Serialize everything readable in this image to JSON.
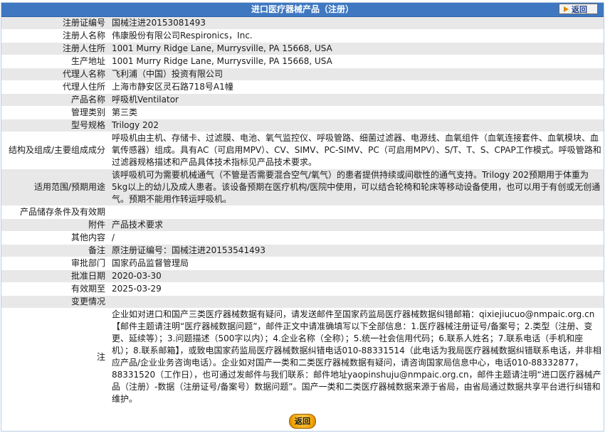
{
  "header": {
    "title": "进口医疗器械产品（注册）",
    "back_label": "返回"
  },
  "rows": [
    {
      "label": "注册证编号",
      "value": "国械注进20153081493"
    },
    {
      "label": "注册人名称",
      "value": "伟康股份有限公司Respironics，Inc."
    },
    {
      "label": "注册人住所",
      "value": "1001 Murry Ridge Lane, Murrysville, PA 15668, USA"
    },
    {
      "label": "生产地址",
      "value": "1001 Murry Ridge Lane, Murrysville, PA 15668, USA"
    },
    {
      "label": "代理人名称",
      "value": "飞利浦（中国）投资有限公司"
    },
    {
      "label": "代理人住所",
      "value": "上海市静安区灵石路718号A1幢"
    },
    {
      "label": "产品名称",
      "value": "呼吸机Ventilator"
    },
    {
      "label": "管理类别",
      "value": "第三类"
    },
    {
      "label": "型号规格",
      "value": "Trilogy 202"
    },
    {
      "label": "结构及组成/主要组成成分",
      "value": "呼吸机由主机、存储卡、过滤膜、电池、氧气监控仪、呼吸管路、细菌过滤器、电源线、血氧组件（血氧连接套件、血氧模块、血氧传感器）组成。具有AC（可启用MPV）、CV、SIMV、PC-SIMV、PC（可启用MPV）、S/T、T、S、CPAP工作模式。呼吸管路和过滤器规格描述和产品具体技术指标见产品技术要求。"
    },
    {
      "label": "适用范围/预期用途",
      "value": "该呼吸机可为需要机械通气（不管是否需要混合空气/氧气）的患者提供持续或间歇性的通气支持。Trilogy 202预期用于体重为5kg以上的幼儿及成人患者。该设备预期在医疗机构/医院中使用，可以结合轮椅和轮床等移动设备使用，也可以用于有创或无创通气。预期不能用作转运呼吸机。"
    },
    {
      "label": "产品储存条件及有效期",
      "value": ""
    },
    {
      "label": "附件",
      "value": "产品技术要求"
    },
    {
      "label": "其他内容",
      "value": "/"
    },
    {
      "label": "备注",
      "value": "原注册证编号：国械注进20153541493"
    },
    {
      "label": "审批部门",
      "value": "国家药品监督管理局"
    },
    {
      "label": "批准日期",
      "value": "2020-03-30"
    },
    {
      "label": "有效期至",
      "value": "2025-03-29"
    },
    {
      "label": "变更情况",
      "value": ""
    },
    {
      "label": "注",
      "value": "企业如对进口和国产三类医疗器械数据有疑问，请发送邮件至国家药监局医疗器械数据纠错邮箱：qixiejiucuo@nmpaic.org.cn【邮件主题请注明“医疗器械数据问题”，邮件正文中请准确填写以下全部信息：1.医疗器械注册证号/备案号；2.类型（注册、变更、延续等）；3.问题描述（500字以内）；4.企业名称（全称）；5.统一社会信用代码；6.联系人姓名；7.联系电话（手机和座机）；8.联系邮箱】，或致电国家药监局医疗器械数据纠错电话010-88331514（此电话为我局医疗器械数据纠错联系电话，并非相应产品/企业业务咨询电话）。企业如对国产一类和二类医疗器械数据有疑问，请咨询国家局信息中心，电话010-88332877，88331520（工作日），也可通过发邮件与我们联系：邮件地址yaopinshuju@nmpaic.org.cn，邮件主题请注明“进口医疗器械产品（注册）-数据（注册证号/备案号）数据问题”。国产一类和二类医疗器械数据来源于省局，由省局通过数据共享平台进行纠错和维护。"
    }
  ],
  "footer": {
    "back_label": "返回"
  }
}
